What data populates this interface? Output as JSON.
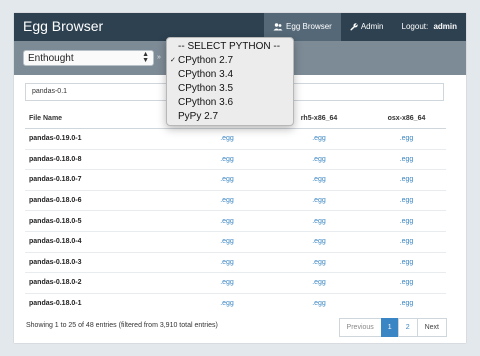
{
  "navbar": {
    "brand": "Egg Browser",
    "items": [
      {
        "label": "Egg Browser",
        "icon": "users-icon",
        "active": true
      },
      {
        "label": "Admin",
        "icon": "wrench-icon",
        "active": false
      }
    ],
    "logout_prefix": "Logout: ",
    "logout_user": "admin"
  },
  "toolbar": {
    "organization": "Enthought",
    "separator": "»",
    "python_dropdown": {
      "header": "-- SELECT PYTHON --",
      "options": [
        {
          "label": "CPython 2.7",
          "selected": true
        },
        {
          "label": "CPython 3.4",
          "selected": false
        },
        {
          "label": "CPython 3.5",
          "selected": false
        },
        {
          "label": "CPython 3.6",
          "selected": false
        },
        {
          "label": "PyPy 2.7",
          "selected": false
        }
      ]
    }
  },
  "search": {
    "value": "pandas-0.1"
  },
  "table": {
    "columns": [
      "File Name",
      "",
      "rh5-x86_64",
      "osx-x86_64"
    ],
    "rows": [
      {
        "name": "pandas-0.19.0-1",
        "links": [
          ".egg",
          ".egg",
          ".egg"
        ]
      },
      {
        "name": "pandas-0.18.0-8",
        "links": [
          ".egg",
          ".egg",
          ".egg"
        ]
      },
      {
        "name": "pandas-0.18.0-7",
        "links": [
          ".egg",
          ".egg",
          ".egg"
        ]
      },
      {
        "name": "pandas-0.18.0-6",
        "links": [
          ".egg",
          ".egg",
          ".egg"
        ]
      },
      {
        "name": "pandas-0.18.0-5",
        "links": [
          ".egg",
          ".egg",
          ".egg"
        ]
      },
      {
        "name": "pandas-0.18.0-4",
        "links": [
          ".egg",
          ".egg",
          ".egg"
        ]
      },
      {
        "name": "pandas-0.18.0-3",
        "links": [
          ".egg",
          ".egg",
          ".egg"
        ]
      },
      {
        "name": "pandas-0.18.0-2",
        "links": [
          ".egg",
          ".egg",
          ".egg"
        ]
      },
      {
        "name": "pandas-0.18.0-1",
        "links": [
          ".egg",
          ".egg",
          ".egg"
        ]
      }
    ]
  },
  "footer": {
    "info": "Showing 1 to 25 of 48 entries (filtered from 3,910 total entries)",
    "pagination": {
      "previous": "Previous",
      "pages": [
        "1",
        "2"
      ],
      "current": "1",
      "next": "Next"
    }
  },
  "colors": {
    "navbar": "#2d4150",
    "toolbar": "#7d8b97",
    "link": "#3a86c4",
    "active_nav": "#546878"
  }
}
